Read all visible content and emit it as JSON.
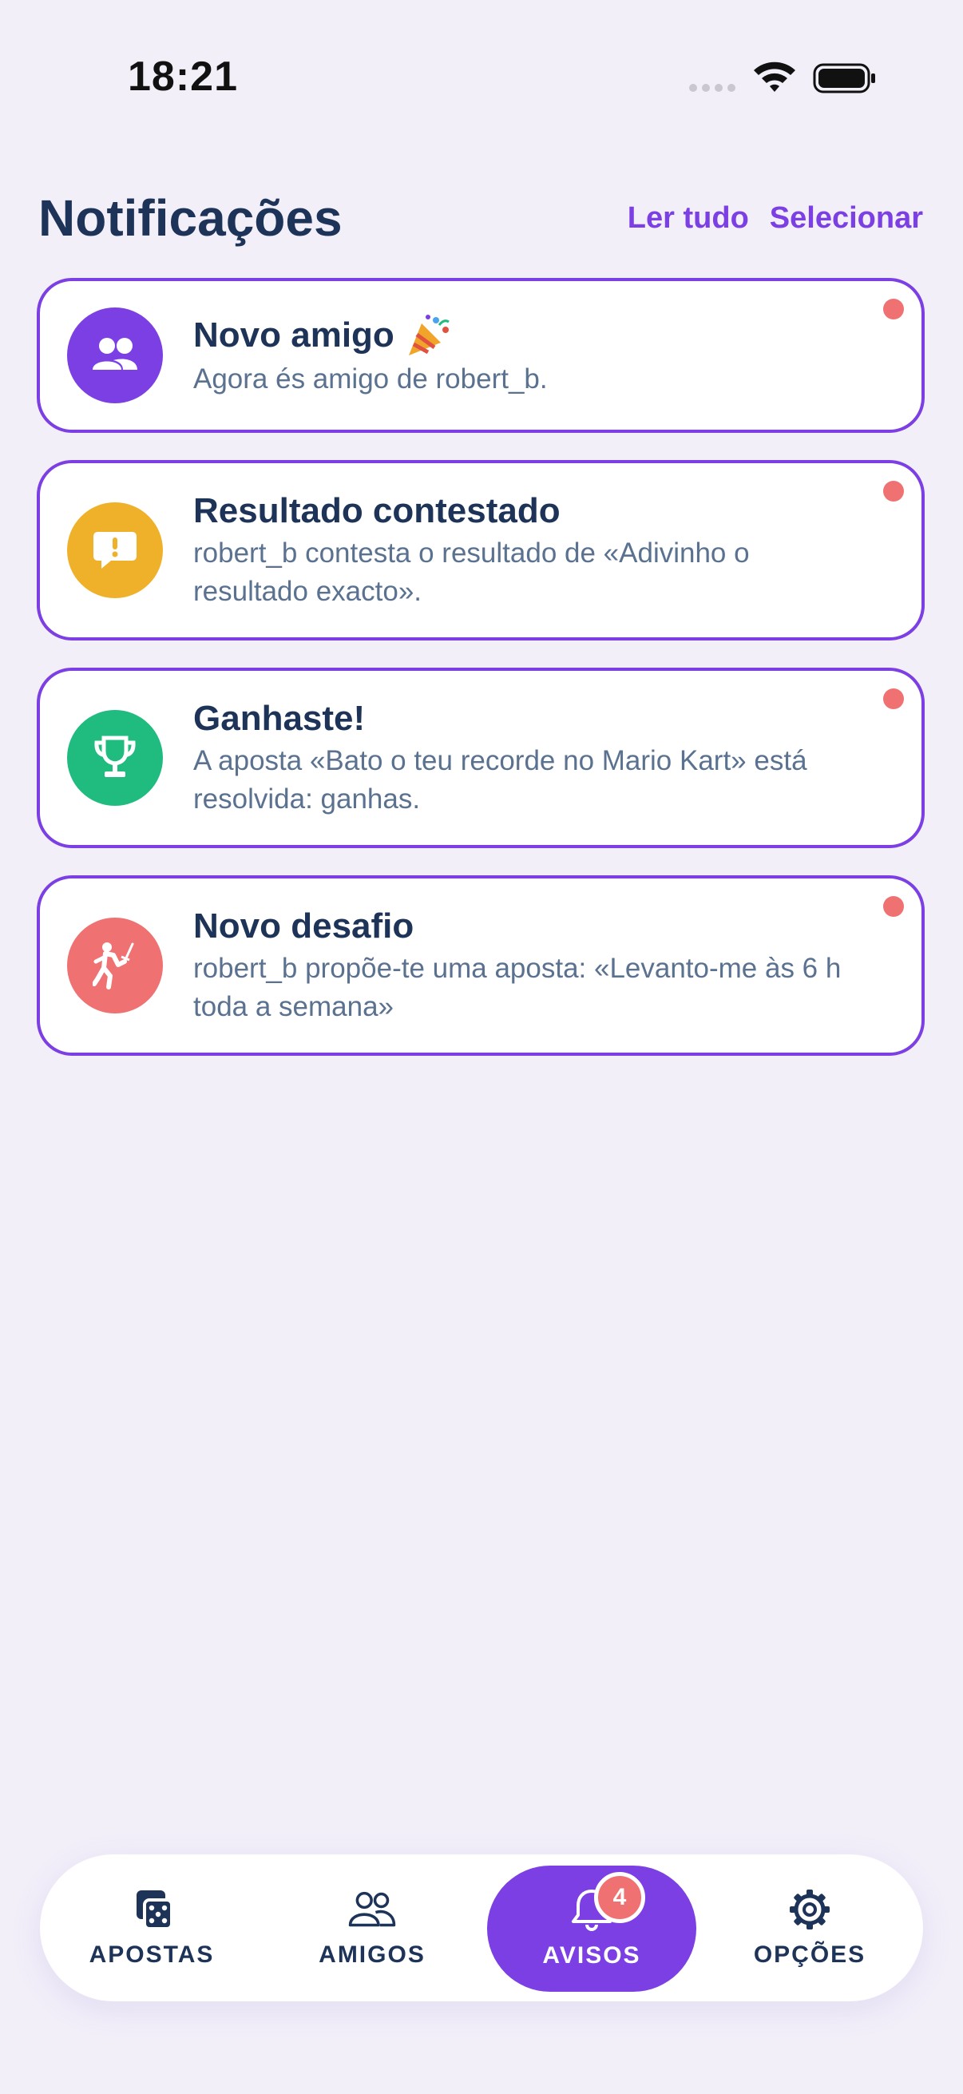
{
  "status_bar": {
    "time": "18:21"
  },
  "header": {
    "title": "Notificações",
    "actions": [
      "Ler tudo",
      "Selecionar"
    ]
  },
  "notifications": [
    {
      "title": "Novo amigo",
      "emoji": "party-popper",
      "body": "Agora és amigo de robert_b.",
      "icon": "friends-icon",
      "color": "#7b3fe4",
      "unread": true
    },
    {
      "title": "Resultado contestado",
      "body": "robert_b contesta o resultado de «Adivinho o resultado exacto».",
      "icon": "dispute-icon",
      "color": "#f0b12a",
      "unread": true
    },
    {
      "title": "Ganhaste!",
      "body": "A aposta «Bato o teu recorde no Mario Kart» está resolvida: ganhas.",
      "icon": "trophy-icon",
      "color": "#1fbb7f",
      "unread": true
    },
    {
      "title": "Novo desafio",
      "body": "robert_b propõe-te uma aposta: «Levanto-me às 6 h toda a semana»",
      "icon": "fencing-icon",
      "color": "#f07171",
      "unread": true
    }
  ],
  "tab_bar": {
    "tabs": [
      {
        "label": "APOSTAS",
        "icon": "dice-icon"
      },
      {
        "label": "AMIGOS",
        "icon": "friends-outline-icon"
      },
      {
        "label": "AVISOS",
        "icon": "bell-icon",
        "active": true,
        "badge": "4"
      },
      {
        "label": "OPÇÕES",
        "icon": "gear-icon"
      }
    ]
  },
  "colors": {
    "accent": "#7b3fe4",
    "background": "#f2eff9",
    "text": "#1e3358",
    "unread": "#f07171"
  }
}
